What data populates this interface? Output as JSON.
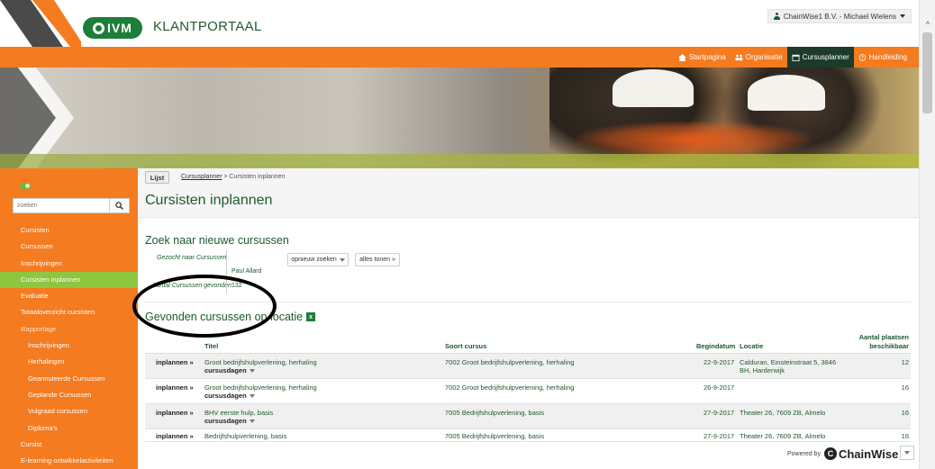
{
  "header": {
    "logo_text": "IVM",
    "portal_title": "KLANTPORTAAL",
    "user_menu": "ChainWise1 B.V. - Michael Wielens"
  },
  "nav": {
    "items": [
      {
        "label": "Startpagina",
        "icon": "home-icon"
      },
      {
        "label": "Organisatie",
        "icon": "people-icon"
      },
      {
        "label": "Cursusplanner",
        "icon": "calendar-icon",
        "active": true
      },
      {
        "label": "Handleiding",
        "icon": "help-icon"
      }
    ]
  },
  "sidebar": {
    "search_placeholder": "zoeken",
    "items": [
      {
        "label": "Cursisten",
        "sub": false
      },
      {
        "label": "Cursussen",
        "sub": false
      },
      {
        "label": "Inschrijvingen",
        "sub": false
      },
      {
        "label": "Cursisten inplannen",
        "sub": false,
        "active": true
      },
      {
        "label": "Evaluatie",
        "sub": false
      },
      {
        "label": "Totaaloverzicht cursisten",
        "sub": false
      },
      {
        "label": "Rapportage",
        "sub": false,
        "section": true
      },
      {
        "label": "Inschrijvingen",
        "sub": true
      },
      {
        "label": "Herhalingen",
        "sub": true
      },
      {
        "label": "Geannuleerde Cursussen",
        "sub": true
      },
      {
        "label": "Geplande Cursussen",
        "sub": true
      },
      {
        "label": "Vulgraad cursussen",
        "sub": true
      },
      {
        "label": "Diploma's",
        "sub": true
      },
      {
        "label": "Cursist",
        "sub": false
      },
      {
        "label": "E-learning ontwikkelactiviteiten",
        "sub": false
      }
    ]
  },
  "main": {
    "lijst_button": "Lijst",
    "breadcrumb_link": "Cursusplanner",
    "breadcrumb_sep": " > ",
    "breadcrumb_current": "Cursisten inplannen",
    "page_title": "Cursisten inplannen",
    "search_section_title": "Zoek naar nieuwe cursussen",
    "searched_label": "Gezocht naar Cursussen",
    "searched_value": "Paul Allard",
    "found_label": "Aantal Cursussen gevonden",
    "found_value": "132",
    "btn_search_again": "opnieuw zoeken",
    "btn_show_all": "alles tonen »",
    "results_title": "Gevonden cursussen op locatie",
    "table": {
      "headers": {
        "titel": "Titel",
        "soort": "Soort cursus",
        "begindatum": "Begindatum",
        "locatie": "Locatie",
        "plaatsen_1": "Aantal plaatsen",
        "plaatsen_2": "beschikbaar"
      },
      "rows": [
        {
          "action": "inplannen »",
          "titel": "Groot bedrijfshulpverlening, herhaling",
          "cursusdagen": "cursusdagen",
          "soort": "7002 Groot bedrijfshulpverlening, herhaling",
          "begindatum": "22-9-2017",
          "locatie_1": "Calduran, Einsteinstraat 5, 3846",
          "locatie_2": "BH, Harderwijk",
          "plaatsen": "12"
        },
        {
          "action": "inplannen »",
          "titel": "Groot bedrijfshulpverlening, herhaling",
          "cursusdagen": "cursusdagen",
          "soort": "7002 Groot bedrijfshulpverlening, herhaling",
          "begindatum": "26-9-2017",
          "locatie_1": "",
          "locatie_2": "",
          "plaatsen": "16"
        },
        {
          "action": "inplannen »",
          "titel": "BHV eerste hulp, basis",
          "cursusdagen": "cursusdagen",
          "soort": "7005 Bedrijfshulpverlening, basis",
          "begindatum": "27-9-2017",
          "locatie_1": "Theater 26, 7609 ZB, Almelo",
          "locatie_2": "",
          "plaatsen": "16"
        },
        {
          "action": "inplannen »",
          "titel": "Bedrijfshulpverlening, basis",
          "cursusdagen": "",
          "soort": "7005 Bedrijfshulpverlening, basis",
          "begindatum": "27-9-2017",
          "locatie_1": "Theater 26, 7609 ZB, Almelo",
          "locatie_2": "",
          "plaatsen": "16"
        }
      ]
    }
  },
  "footer": {
    "powered_by": "Powered by",
    "brand": "ChainWise"
  }
}
